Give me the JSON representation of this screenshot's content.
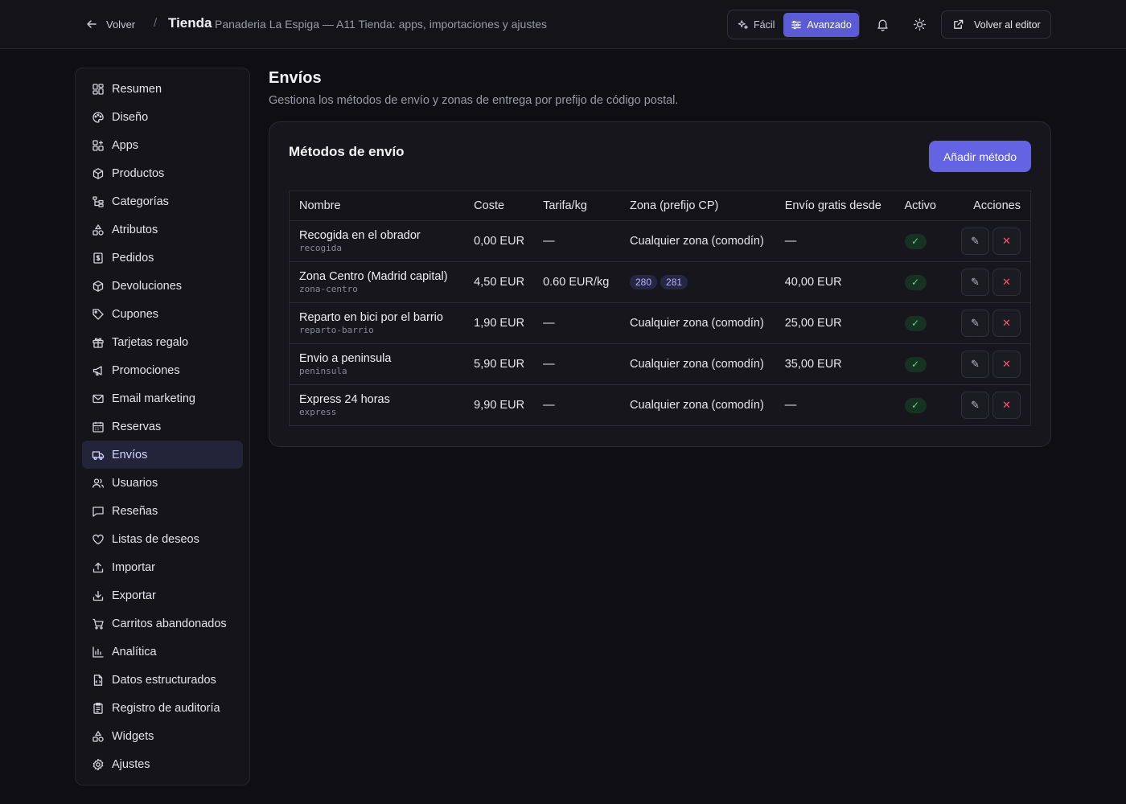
{
  "header": {
    "back_label": "Volver",
    "separator": "/",
    "title": "Tienda",
    "subtitle": "Panaderia La Espiga — A11 Tienda: apps, importaciones y ajustes",
    "mode_easy": "Fácil",
    "mode_advanced": "Avanzado",
    "active_mode": "Avanzado",
    "editor_label": "Volver al editor"
  },
  "sidebar": {
    "items": [
      {
        "label": "Resumen",
        "icon": "grid-icon"
      },
      {
        "label": "Diseño",
        "icon": "palette-icon"
      },
      {
        "label": "Apps",
        "icon": "apps-icon"
      },
      {
        "label": "Productos",
        "icon": "box-icon"
      },
      {
        "label": "Categorías",
        "icon": "tree-icon"
      },
      {
        "label": "Atributos",
        "icon": "shapes-icon"
      },
      {
        "label": "Pedidos",
        "icon": "receipt-icon"
      },
      {
        "label": "Devoluciones",
        "icon": "return-box-icon"
      },
      {
        "label": "Cupones",
        "icon": "tag-icon"
      },
      {
        "label": "Tarjetas regalo",
        "icon": "gift-icon"
      },
      {
        "label": "Promociones",
        "icon": "megaphone-icon"
      },
      {
        "label": "Email marketing",
        "icon": "mail-icon"
      },
      {
        "label": "Reservas",
        "icon": "calendar-icon"
      },
      {
        "label": "Envíos",
        "icon": "truck-icon"
      },
      {
        "label": "Usuarios",
        "icon": "users-icon"
      },
      {
        "label": "Reseñas",
        "icon": "message-icon"
      },
      {
        "label": "Listas de deseos",
        "icon": "heart-icon"
      },
      {
        "label": "Importar",
        "icon": "upload-icon"
      },
      {
        "label": "Exportar",
        "icon": "download-icon"
      },
      {
        "label": "Carritos abandonados",
        "icon": "cart-icon"
      },
      {
        "label": "Analítica",
        "icon": "bar-chart-icon"
      },
      {
        "label": "Datos estructurados",
        "icon": "file-code-icon"
      },
      {
        "label": "Registro de auditoría",
        "icon": "clipboard-icon"
      },
      {
        "label": "Widgets",
        "icon": "widgets-icon"
      },
      {
        "label": "Ajustes",
        "icon": "gear-icon"
      }
    ],
    "active": "Envíos"
  },
  "main": {
    "title": "Envíos",
    "description": "Gestiona los métodos de envío y zonas de entrega por prefijo de código postal.",
    "card_title": "Métodos de envío",
    "add_button": "Añadir método",
    "table": {
      "headers": [
        "Nombre",
        "Coste",
        "Tarifa/kg",
        "Zona (prefijo CP)",
        "Envío gratis desde",
        "Activo",
        "Acciones"
      ],
      "rows": [
        {
          "name": "Recogida en el obrador",
          "slug": "recogida",
          "cost": "0,00 EUR",
          "rate": "—",
          "zone": "Cualquier zona (comodín)",
          "zones": [],
          "free_from": "—",
          "active": "✓"
        },
        {
          "name": "Zona Centro (Madrid capital)",
          "slug": "zona-centro",
          "cost": "4,50 EUR",
          "rate": "0.60 EUR/kg",
          "zone": "",
          "zones": [
            "280",
            "281"
          ],
          "free_from": "40,00 EUR",
          "active": "✓"
        },
        {
          "name": "Reparto en bici por el barrio",
          "slug": "reparto-barrio",
          "cost": "1,90 EUR",
          "rate": "—",
          "zone": "Cualquier zona (comodín)",
          "zones": [],
          "free_from": "25,00 EUR",
          "active": "✓"
        },
        {
          "name": "Envio a peninsula",
          "slug": "peninsula",
          "cost": "5,90 EUR",
          "rate": "—",
          "zone": "Cualquier zona (comodín)",
          "zones": [],
          "free_from": "35,00 EUR",
          "active": "✓"
        },
        {
          "name": "Express 24 horas",
          "slug": "express",
          "cost": "9,90 EUR",
          "rate": "—",
          "zone": "Cualquier zona (comodín)",
          "zones": [],
          "free_from": "—",
          "active": "✓"
        }
      ],
      "edit_glyph": "✎",
      "delete_glyph": "✕"
    }
  },
  "colors": {
    "accent": "#6363e3",
    "active_nav_bg": "#23233a",
    "success": "#5fd68a",
    "danger": "#ef5b6b"
  }
}
